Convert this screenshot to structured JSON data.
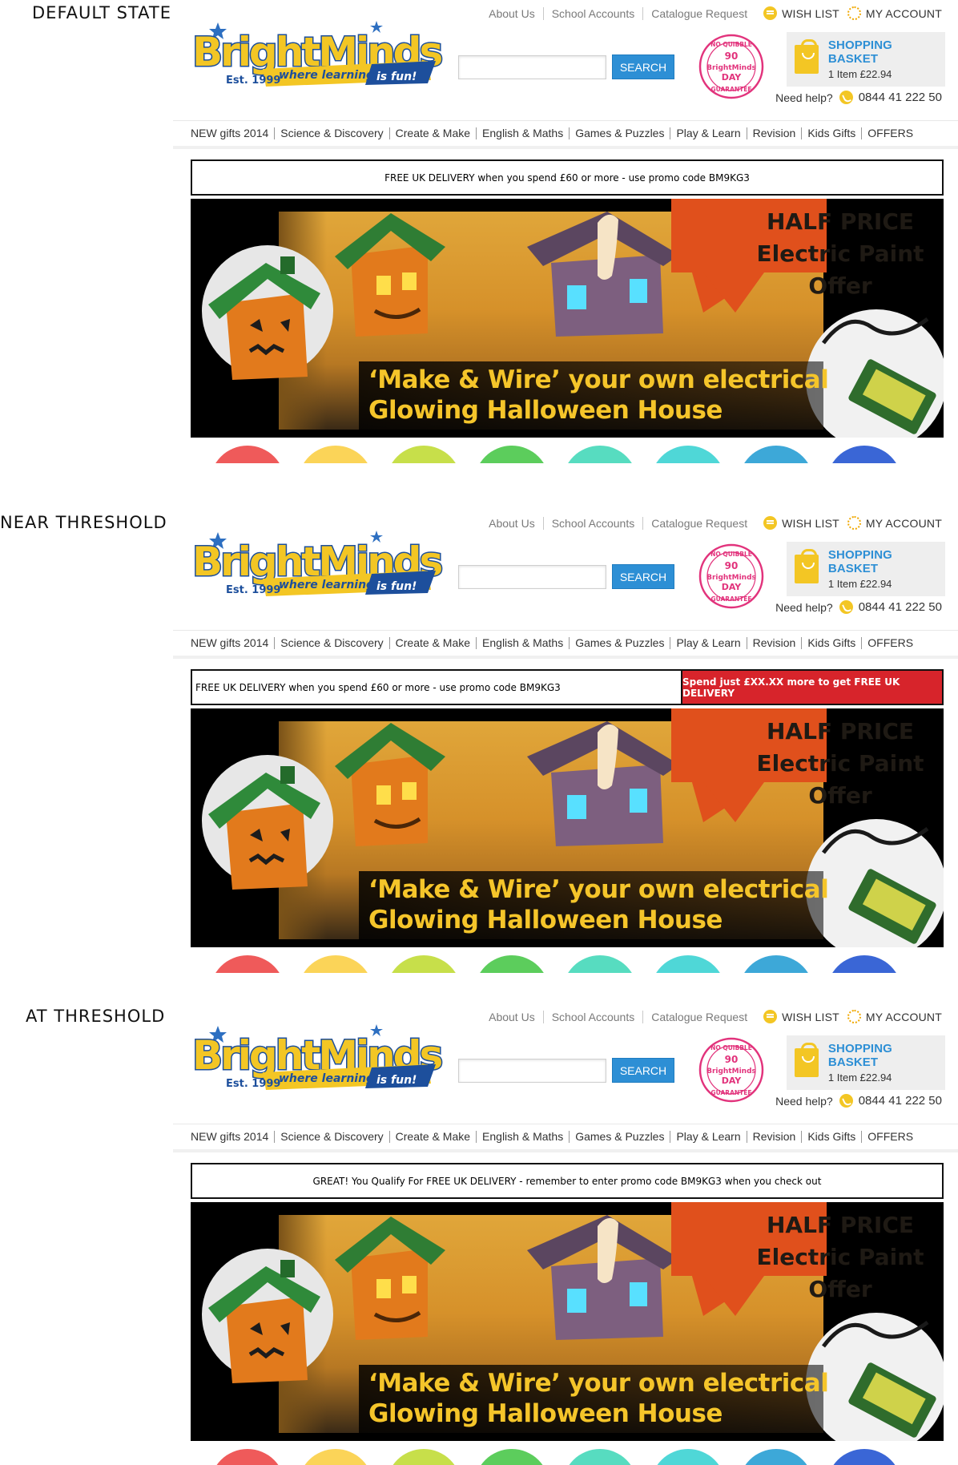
{
  "states": [
    {
      "label": "DEFAULT STATE",
      "promo": {
        "message": "FREE UK DELIVERY when you spend £60 or more - use promo code BM9KG3",
        "threshold_msg": ""
      }
    },
    {
      "label": "NEAR THRESHOLD",
      "promo": {
        "message": "FREE UK DELIVERY when you spend £60 or more - use promo code BM9KG3",
        "threshold_msg": "Spend just £XX.XX more to get FREE UK DELIVERY"
      }
    },
    {
      "label": "AT THRESHOLD",
      "promo": {
        "message": "GREAT! You Qualify For FREE UK DELIVERY - remember to enter promo code BM9KG3 when you check out",
        "threshold_msg": ""
      }
    }
  ],
  "header": {
    "top_links": [
      "About Us",
      "School Accounts",
      "Catalogue Request"
    ],
    "wish_list": "WISH LIST",
    "my_account": "MY ACCOUNT",
    "logo": {
      "name": "BrightMinds",
      "est": "Est. 1999",
      "tagline_a": "where learning",
      "tagline_b": "is fun!"
    },
    "search_button": "SEARCH",
    "search_placeholder": "",
    "stamp": {
      "top": "NO QUIBBLE",
      "days": "90",
      "brand": "BrightMinds",
      "day": "DAY",
      "bottom": "GUARANTEE"
    },
    "basket": {
      "title": "SHOPPING BASKET",
      "summary": "1 Item £22.94"
    },
    "help": {
      "label": "Need help?",
      "phone": "0844 41 222 50"
    }
  },
  "nav": [
    "NEW gifts 2014",
    "Science & Discovery",
    "Create & Make",
    "English & Maths",
    "Games & Puzzles",
    "Play & Learn",
    "Revision",
    "Kids Gifts",
    "OFFERS"
  ],
  "hero": {
    "offer_line1": "HALF PRICE",
    "offer_line2": "Electric Paint",
    "offer_line3": "Offer",
    "caption_line1": "‘Make & Wire’ your own electrical",
    "caption_line2": "Glowing Halloween House"
  },
  "colors": {
    "accent_blue": "#2d8fd5",
    "brand_yellow": "#f3c624",
    "offer_orange": "#e0501c",
    "alert_red": "#d7242b",
    "circle_colors": [
      "#ef5a5a",
      "#fbd458",
      "#c7df4a",
      "#5ccd5c",
      "#57dcc0",
      "#4fd7d7",
      "#3da8d8",
      "#3a66d6"
    ]
  }
}
